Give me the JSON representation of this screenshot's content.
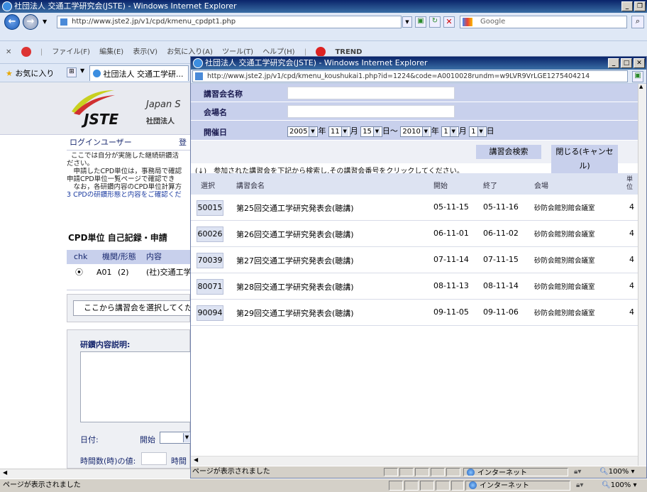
{
  "main_window": {
    "title": "社団法人 交通工学研究会(JSTE) - Windows Internet Explorer",
    "url": "http://www.jste2.jp/v1/cpd/kmenu_cpdpt1.php",
    "search_placeholder": "Google",
    "menu": [
      "ファイル(F)",
      "編集(E)",
      "表示(V)",
      "お気に入り(A)",
      "ツール(T)",
      "ヘルプ(H)"
    ],
    "trend": "TREND",
    "trend_protect": "Trend プロテクト™",
    "favorites": "お気に入り",
    "tab": "社団法人 交通工学研...",
    "status": "ページが表示されました",
    "zone": "インターネット",
    "zoom": "100%"
  },
  "left_page": {
    "logo": "JSTE",
    "org_en": "Japan S",
    "org_ja": "社団法人",
    "login_label": "ログインユーザー",
    "login_extra": "登",
    "intro": [
      "ここでは自分が実施した継続研鑽活",
      "ださい。",
      "　申請したCPD単位は，事務局で確認",
      "申請CPD単位一覧ページで確認でき",
      "　なお，各研鑽内容のCPD単位計算方",
      "3 CPDの研鑽形態と内容をご確認くだ"
    ],
    "section_title": "CPD単位 自己記録・申請",
    "cols": [
      "chk",
      "機関/形態",
      "内容"
    ],
    "row": {
      "code": "A01",
      "form": "(2)",
      "content": "(社)交通工学"
    },
    "select_button": "ここから講習会を選択してくだ",
    "desc_label": "研鑽内容説明:",
    "date_label": "日付:",
    "start_label": "開始",
    "hours_label": "時間数(時)の値:",
    "hours_unit": "時間"
  },
  "popup": {
    "title": "社団法人 交通工学研究会(JSTE) - Windows Internet Explorer",
    "url": "http://www.jste2.jp/v1/cpd/kmenu_koushukai1.php?id=1224&code=A0010028rundm=w9LVR9VrLGE1275404214",
    "fields": {
      "course_name": "講習会名称",
      "venue": "会場名",
      "date": "開催日"
    },
    "date": {
      "y1": "2005",
      "m1": "11",
      "d1": "15",
      "y2": "2010",
      "m2": "1",
      "d2": "1",
      "year": "年",
      "month": "月",
      "day": "日",
      "tilde": "～"
    },
    "search_button": "講習会検索",
    "close_button": "閉じる(キャンセル)",
    "instruction": "(↓)　参加された講習会を下記から検索し,その講習会番号をクリックしてください。",
    "headers": [
      "選択",
      "講習会名",
      "開始",
      "終了",
      "会場",
      "単位"
    ],
    "rows": [
      {
        "code": "50015",
        "name": "第25回交通工学研究発表会(聴講)",
        "start": "05-11-15",
        "end": "05-11-16",
        "venue": "砂防会館別館会議室",
        "units": "4"
      },
      {
        "code": "60026",
        "name": "第26回交通工学研究発表会(聴講)",
        "start": "06-11-01",
        "end": "06-11-02",
        "venue": "砂防会館別館会議室",
        "units": "4"
      },
      {
        "code": "70039",
        "name": "第27回交通工学研究発表会(聴講)",
        "start": "07-11-14",
        "end": "07-11-15",
        "venue": "砂防会館別館会議室",
        "units": "4"
      },
      {
        "code": "80071",
        "name": "第28回交通工学研究発表会(聴講)",
        "start": "08-11-13",
        "end": "08-11-14",
        "venue": "砂防会館別館会議室",
        "units": "4"
      },
      {
        "code": "90094",
        "name": "第29回交通工学研究発表会(聴講)",
        "start": "09-11-05",
        "end": "09-11-06",
        "venue": "砂防会館別館会議室",
        "units": "4"
      }
    ],
    "status": "ページが表示されました",
    "zone": "インターネット",
    "zoom": "100%"
  }
}
